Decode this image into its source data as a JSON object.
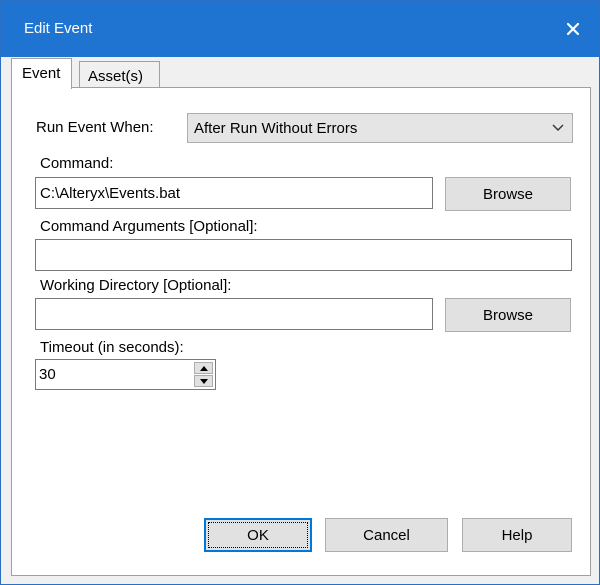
{
  "window": {
    "title": "Edit Event",
    "close_icon": "close-icon",
    "titlebar_color": "#1e74d0"
  },
  "tabs": [
    {
      "label": "Event",
      "active": true
    },
    {
      "label": "Asset(s)",
      "active": false
    }
  ],
  "form": {
    "run_event_when": {
      "label": "Run Event When:",
      "selected": "After Run Without Errors"
    },
    "command": {
      "label": "Command:",
      "value": "C:\\Alteryx\\Events.bat",
      "browse_label": "Browse"
    },
    "command_arguments": {
      "label": "Command Arguments [Optional]:",
      "value": ""
    },
    "working_directory": {
      "label": "Working Directory [Optional]:",
      "value": "",
      "browse_label": "Browse"
    },
    "timeout": {
      "label": "Timeout (in seconds):",
      "value": "30"
    }
  },
  "buttons": {
    "ok": "OK",
    "cancel": "Cancel",
    "help": "Help"
  }
}
